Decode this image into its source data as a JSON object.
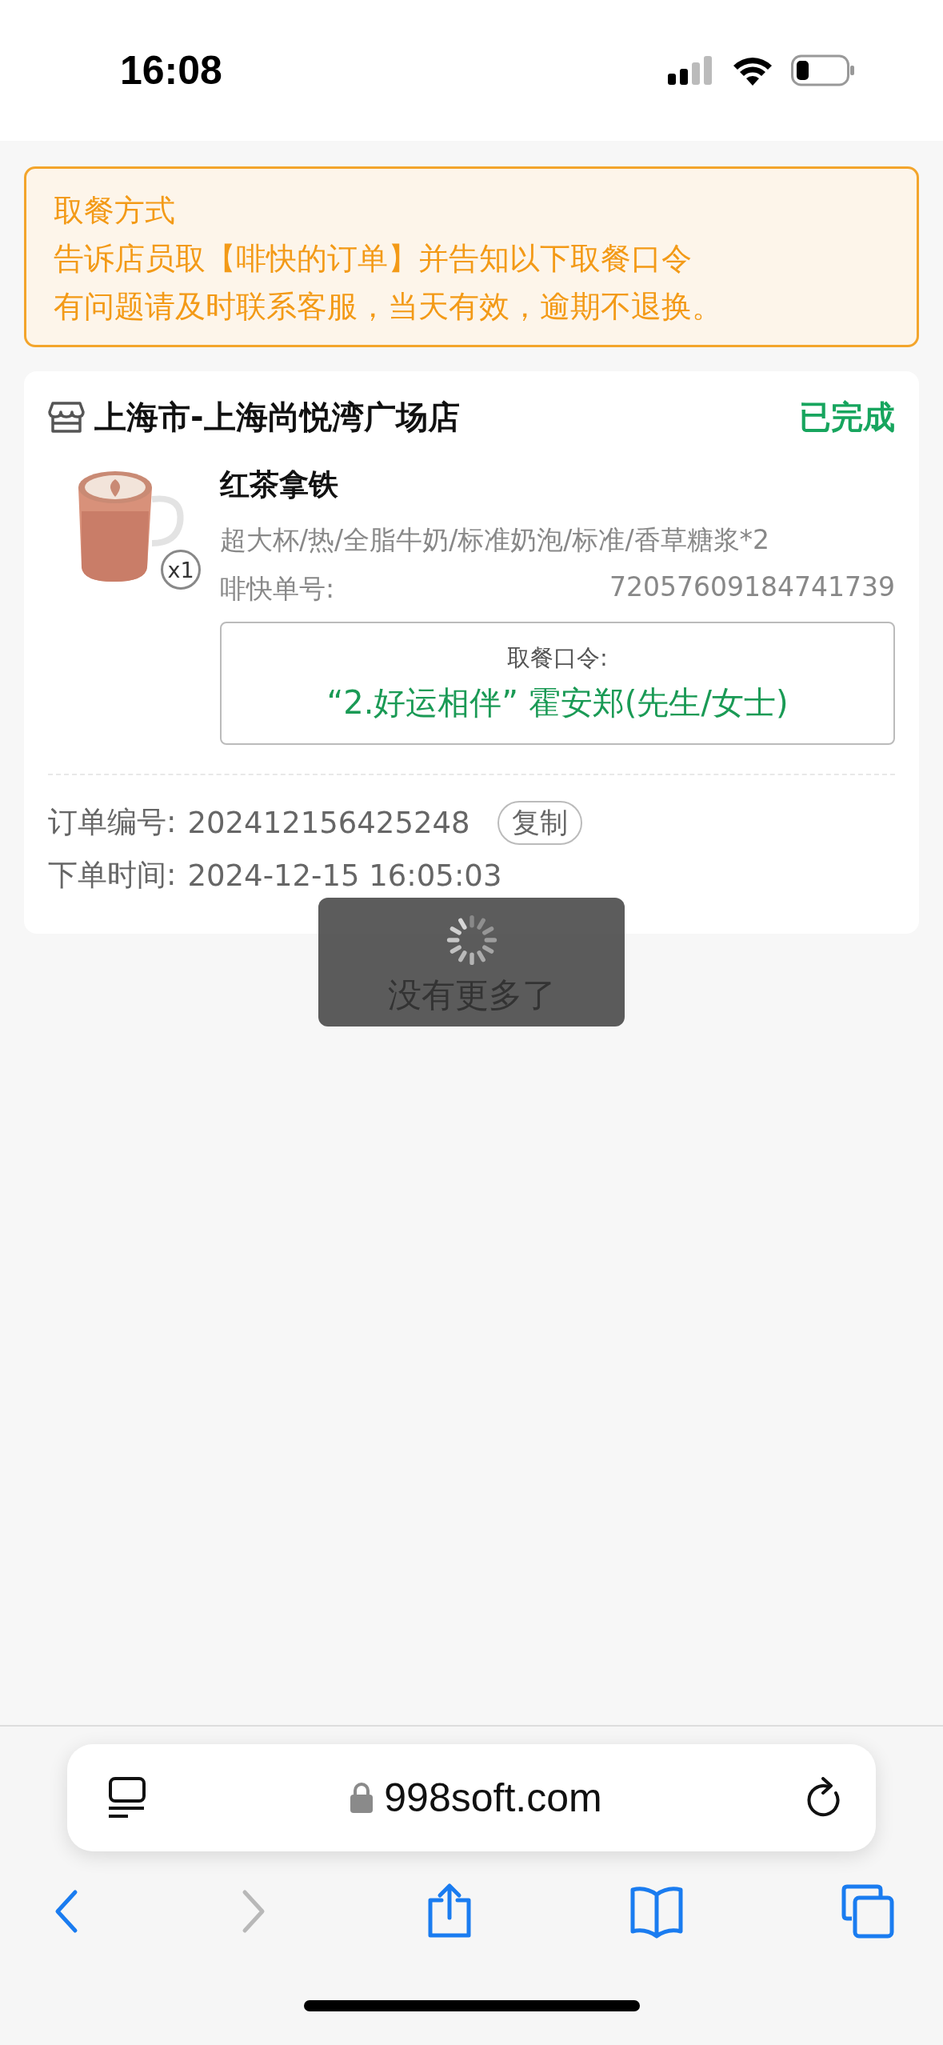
{
  "status_bar": {
    "time": "16:08"
  },
  "notice": {
    "title": "取餐方式",
    "lines": [
      "告诉店员取【啡快的订单】并告知以下取餐口令",
      "有问题请及时联系客服，当天有效，逾期不退换。"
    ]
  },
  "order": {
    "store": "上海市-上海尚悦湾广场店",
    "status": "已完成",
    "items": [
      {
        "kind": "picture",
        "quantity": "x1",
        "name": "红茶拿铁",
        "options": "超大杯/热/全脂牛奶/标准奶泡/标准/香草糖浆*2",
        "code_label": "啡快单号:",
        "code": "72057609184741739"
      }
    ],
    "pickup": {
      "label": "取餐口令:",
      "phrase": "“2.好运相伴” 霍安郑(先生/女士)"
    },
    "order_number": {
      "label": "订单编号:",
      "value": "202412156425248",
      "copy_button": "复制"
    },
    "order_time": {
      "label": "下单时间:",
      "value": "2024-12-15 16:05:03"
    }
  },
  "toast": {
    "text": "没有更多了"
  },
  "browser": {
    "url": "998soft.com",
    "toolbar": [
      {
        "kind": "back",
        "disabled": false
      },
      {
        "kind": "forward",
        "disabled": true
      },
      {
        "kind": "share",
        "disabled": false
      },
      {
        "kind": "bookmarks",
        "disabled": false
      },
      {
        "kind": "tabs",
        "disabled": false
      }
    ]
  }
}
